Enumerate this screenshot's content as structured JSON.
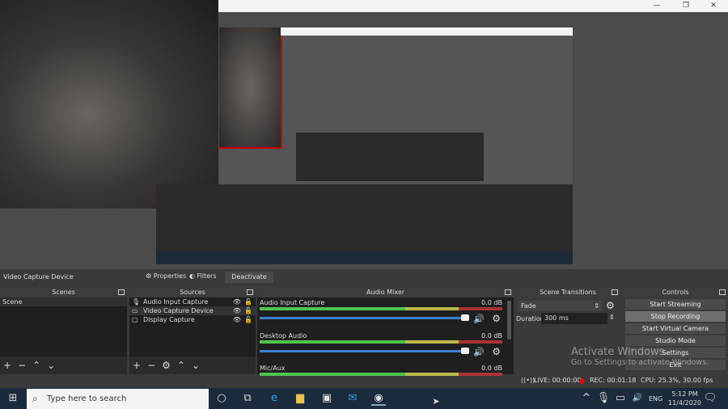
{
  "source_toolbar": {
    "source_name": "Video Capture Device",
    "properties": "Properties",
    "filters": "Filters",
    "deactivate": "Deactivate"
  },
  "scenes": {
    "title": "Scenes",
    "items": [
      "Scene"
    ]
  },
  "sources": {
    "title": "Sources",
    "items": [
      {
        "name": "Audio Input Capture",
        "icon": "microphone-icon"
      },
      {
        "name": "Video Capture Device",
        "icon": "camera-icon"
      },
      {
        "name": "Display Capture",
        "icon": "monitor-icon"
      }
    ]
  },
  "mixer": {
    "title": "Audio Mixer",
    "channels": [
      {
        "name": "Audio Input Capture",
        "db": "0.0 dB"
      },
      {
        "name": "Desktop Audio",
        "db": "0.0 dB"
      },
      {
        "name": "Mic/Aux",
        "db": "0.0 dB"
      }
    ]
  },
  "transitions": {
    "title": "Scene Transitions",
    "type": "Fade",
    "duration_label": "Duration",
    "duration": "300 ms"
  },
  "controls": {
    "title": "Controls",
    "buttons": [
      "Start Streaming",
      "Stop Recording",
      "Start Virtual Camera",
      "Studio Mode",
      "Settings",
      "Exit"
    ]
  },
  "status": {
    "live": "LIVE: 00:00:00",
    "rec": "REC: 00:01:18",
    "cpu": "CPU: 25.3%, 30.00 fps"
  },
  "watermark": {
    "title": "Activate Windows",
    "subtitle": "Go to Settings to activate Windows."
  },
  "taskbar": {
    "search_placeholder": "Type here to search",
    "lang": "ENG",
    "time": "5:12 PM",
    "date": "11/4/2020"
  },
  "colors": {
    "rec": "#d01010",
    "taskbar": "#1b2a3c",
    "fader": "#3d7fd0"
  }
}
